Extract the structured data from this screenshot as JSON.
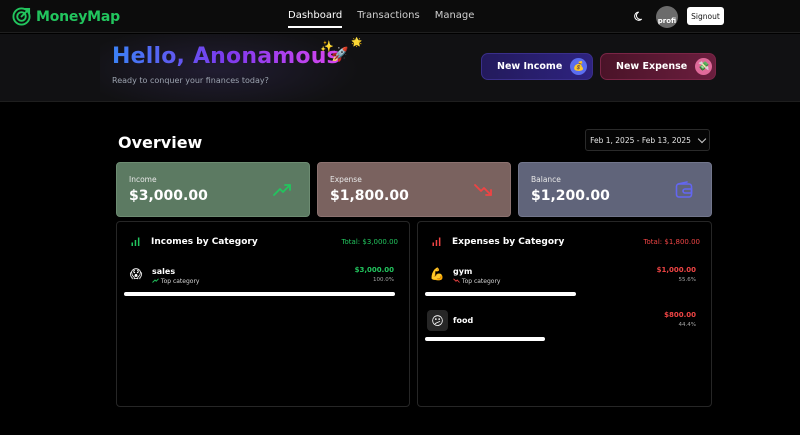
{
  "app": {
    "name": "MoneyMap",
    "brand_color": "#22c55e"
  },
  "nav": {
    "links": [
      {
        "label": "Dashboard",
        "active": true
      },
      {
        "label": "Transactions",
        "active": false
      },
      {
        "label": "Manage",
        "active": false
      }
    ],
    "theme_icon": "moon-icon",
    "avatar_text": "profi",
    "signout_label": "Signout"
  },
  "hero": {
    "greeting": "Hello, Anonamous",
    "subtitle": "Ready to conquer your finances today?",
    "new_income_label": "New Income",
    "new_income_icon": "money-bag-icon",
    "new_expense_label": "New Expense",
    "new_expense_icon": "money-wings-icon"
  },
  "overview": {
    "title": "Overview",
    "date_range": "Feb 1, 2025 - Feb 13, 2025",
    "cards": {
      "income": {
        "label": "Income",
        "value": "$3,000.00",
        "icon": "trending-up-icon",
        "color": "#22c55e"
      },
      "expense": {
        "label": "Expense",
        "value": "$1,800.00",
        "icon": "trending-down-icon",
        "color": "#ef4444"
      },
      "balance": {
        "label": "Balance",
        "value": "$1,200.00",
        "icon": "wallet-icon",
        "color": "#6366f1"
      }
    }
  },
  "incomes_by_category": {
    "title": "Incomes by Category",
    "total": "Total: $3,000.00",
    "items": [
      {
        "emoji": "😱",
        "name": "sales",
        "tag": "Top category",
        "amount": "$3,000.00",
        "percent": "100.0%",
        "share": 1.0
      }
    ]
  },
  "expenses_by_category": {
    "title": "Expenses by Category",
    "total": "Total: $1,800.00",
    "items": [
      {
        "emoji": "💪",
        "name": "gym",
        "tag": "Top category",
        "amount": "$1,000.00",
        "percent": "55.6%",
        "share": 0.556
      },
      {
        "emoji": "😕",
        "name": "food",
        "tag": "",
        "amount": "$800.00",
        "percent": "44.4%",
        "share": 0.444
      }
    ]
  }
}
